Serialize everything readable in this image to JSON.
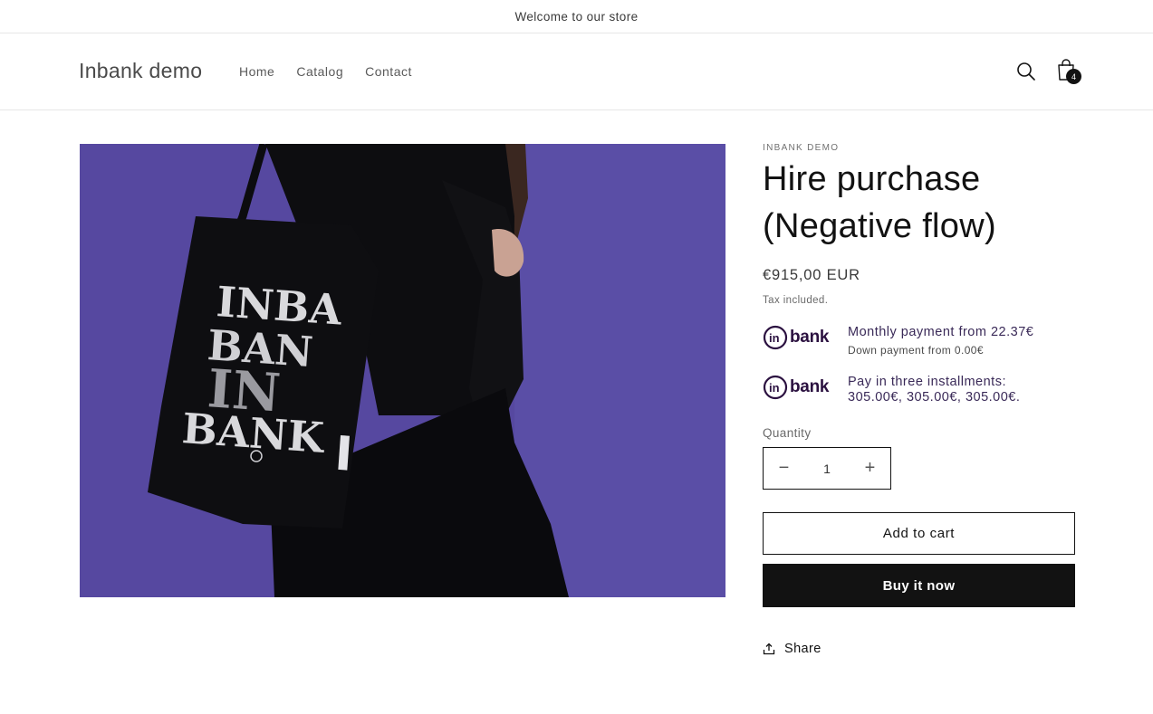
{
  "announcement": {
    "text": "Welcome to our store"
  },
  "header": {
    "brand": "Inbank demo",
    "nav": [
      "Home",
      "Catalog",
      "Contact"
    ],
    "search_icon": "search-icon",
    "cart_icon": "shopping-bag-icon",
    "cart_count": "4"
  },
  "product": {
    "image_icon": "tote-bag-photo",
    "bag_print": [
      "INBA",
      "BAN",
      "IN",
      "BANK"
    ],
    "vendor": "INBANK DEMO",
    "title_line1": "Hire purchase",
    "title_line2": "(Negative flow)",
    "price": "€915,00 EUR",
    "tax": "Tax included.",
    "inbank_logo": "bank",
    "inbank_offers": [
      {
        "main": "Monthly payment from 22.37€",
        "sub": "Down payment from 0.00€"
      },
      {
        "main_line1": "Pay in three installments:",
        "main_line2": "305.00€, 305.00€, 305.00€."
      }
    ],
    "quantity": {
      "label": "Quantity",
      "value": "1",
      "minus": "−",
      "plus": "+"
    },
    "add_to_cart": "Add to cart",
    "buy_now": "Buy it now",
    "share": "Share"
  },
  "colors": {
    "accent": "#121212",
    "inbank": "#2b1140",
    "photo_bg": "#5648a0"
  }
}
